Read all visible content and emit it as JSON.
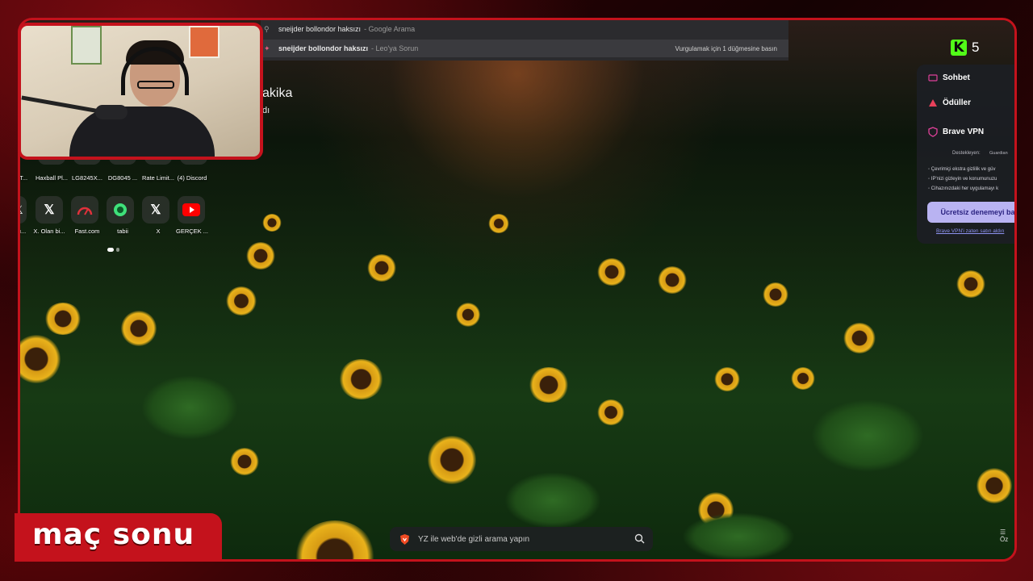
{
  "suggestions": [
    {
      "query": "sneijder bollondor haksızı",
      "source": "- Google Arama"
    },
    {
      "query": "sneijder bollondor haksızı",
      "source": "- Leo'ya Sorun",
      "hint": "Vurgulamak için 1 düğmesine basın"
    }
  ],
  "page": {
    "title_fragment": "akika",
    "sub_fragment": "dı"
  },
  "tiles_row1": [
    "uT...",
    "Haxball Pl...",
    "LG8245X...",
    "DG8045 ...",
    "Rate Limit...",
    "(4) Discord"
  ],
  "tiles_row2": [
    {
      "label": "u...",
      "icon": "x-icon"
    },
    {
      "label": "X. Olan bi...",
      "icon": "x-icon"
    },
    {
      "label": "Fast.com",
      "icon": "speedometer-icon"
    },
    {
      "label": "tabii",
      "icon": "tabii-icon"
    },
    {
      "label": "X",
      "icon": "x-icon"
    },
    {
      "label": "GERÇEK ...",
      "icon": "youtube-icon"
    }
  ],
  "kick": {
    "logo": "K",
    "count": "5"
  },
  "brave_panel": {
    "items": [
      "Sohbet",
      "Ödüller",
      "Brave VPN"
    ],
    "supported_by": "Destekleyen:",
    "guardian": "Guardian",
    "bullets": [
      "Çevrimiçi ekstra gizlilik ve güv",
      "IP'nizi gizleyin ve konumunuzu",
      "Cihazınızdaki her uygulamayı k"
    ],
    "trial_button": "Ücretsiz denemeyi baş",
    "already_link": "Brave VPN'i zaten satın aldın"
  },
  "search": {
    "placeholder": "YZ ile web'de gizli arama yapın"
  },
  "bottom_right": "Öz",
  "overlay_badge": "maç sonu",
  "colors": {
    "frame": "#c4121c",
    "kick": "#52fc18",
    "trial": "#b9b3f2"
  }
}
